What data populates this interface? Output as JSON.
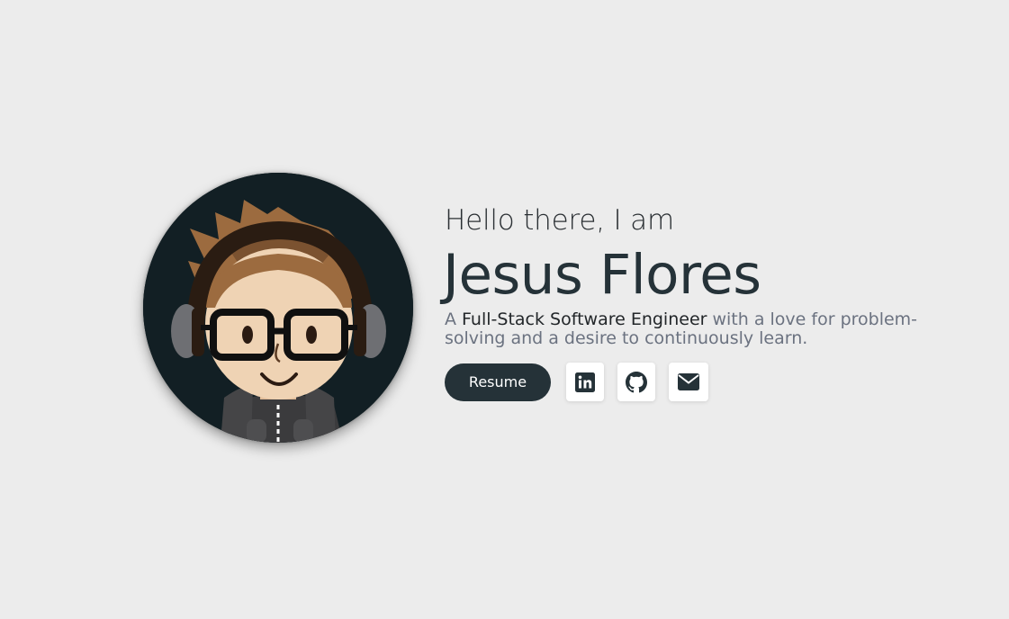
{
  "hero": {
    "greeting": "Hello there, I am",
    "name": "Jesus Flores",
    "tagline_prefix": "A ",
    "tagline_highlight": "Full-Stack Software Engineer",
    "tagline_suffix": " with a love for problem-solving and a desire to continuously learn."
  },
  "actions": {
    "resume_label": "Resume",
    "social": [
      {
        "icon": "linkedin-icon"
      },
      {
        "icon": "github-icon"
      },
      {
        "icon": "envelope-icon"
      }
    ]
  },
  "colors": {
    "background": "#ececec",
    "primary": "#253238",
    "muted_text": "#6b7280"
  }
}
